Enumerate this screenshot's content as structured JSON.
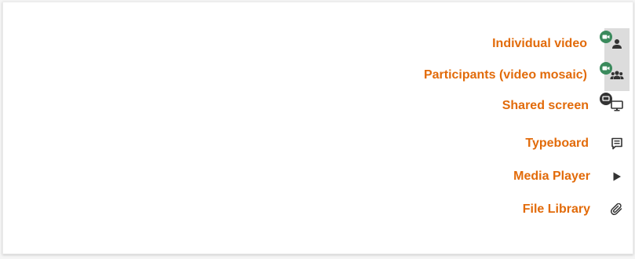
{
  "colors": {
    "label": "#e26b0a",
    "active_bg": "#dcdcdc",
    "video_dot": "#3a8a5c",
    "screen_dot": "#333333",
    "icon": "#333333"
  },
  "panels": [
    {
      "label": "Individual video",
      "icon": "person-icon",
      "dot": "video-camera-icon",
      "active": true
    },
    {
      "label": "Participants (video mosaic)",
      "icon": "group-icon",
      "dot": "video-camera-icon",
      "active": true
    },
    {
      "label": "Shared screen",
      "icon": "monitor-icon",
      "dot": "screen-share-icon",
      "active": false
    },
    {
      "label": "Typeboard",
      "icon": "typeboard-icon",
      "dot": null,
      "active": false
    },
    {
      "label": "Media Player",
      "icon": "play-icon",
      "dot": null,
      "active": false
    },
    {
      "label": "File Library",
      "icon": "paperclip-icon",
      "dot": null,
      "active": false
    }
  ]
}
